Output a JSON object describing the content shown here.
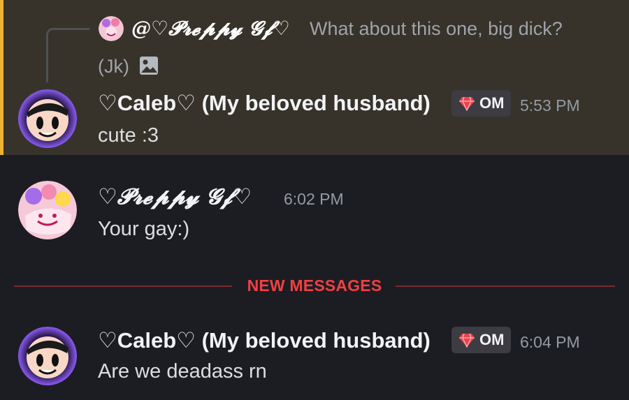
{
  "reply": {
    "author": "@♡𝓟𝓻𝓮𝓹𝓹𝔂 𝓖𝓯♡",
    "preview_line1": "What about this one, big dick?",
    "preview_line2": "(Jk)"
  },
  "messages": [
    {
      "author": "♡Caleb♡ (My beloved husband)",
      "role_tag": "OM",
      "timestamp": "5:53 PM",
      "text": "cute :3",
      "highlighted": true
    },
    {
      "author": "♡𝓟𝓻𝓮𝓹𝓹𝔂 𝓖𝓯♡",
      "timestamp": "6:02 PM",
      "text": "Your gay:)"
    },
    {
      "author": "♡Caleb♡ (My beloved husband)",
      "role_tag": "OM",
      "timestamp": "6:04 PM",
      "text": "Are we deadass rn"
    }
  ],
  "divider": {
    "label": "NEW MESSAGES"
  },
  "colors": {
    "background": "#1c1d22",
    "mention_background": "#37332a",
    "mention_bar": "#f0b232",
    "new_messages_red": "#f23f43",
    "role_gem": "#e8444e"
  },
  "icons": [
    "image-icon",
    "gem-icon"
  ]
}
